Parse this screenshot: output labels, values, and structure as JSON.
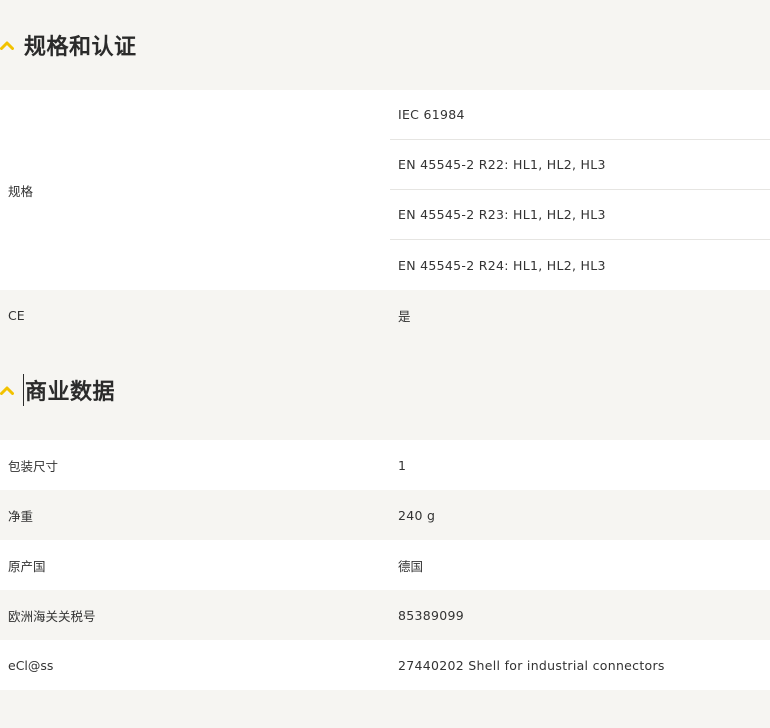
{
  "spec_section": {
    "title": "规格和认证",
    "rows": [
      {
        "label": "规格",
        "values": [
          "IEC 61984",
          "EN 45545-2 R22: HL1, HL2, HL3",
          "EN 45545-2 R23: HL1, HL2, HL3",
          "EN 45545-2 R24: HL1, HL2, HL3"
        ]
      },
      {
        "label": "CE",
        "value": "是"
      }
    ]
  },
  "commercial_section": {
    "title": "商业数据",
    "rows": [
      {
        "label": "包装尺寸",
        "value": "1"
      },
      {
        "label": "净重",
        "value": "240 g"
      },
      {
        "label": "原产国",
        "value": "德国"
      },
      {
        "label": "欧洲海关关税号",
        "value": "85389099"
      },
      {
        "label": "eCl@ss",
        "value": "27440202 Shell for industrial connectors"
      }
    ]
  },
  "colors": {
    "accent": "#f2c200",
    "background": "#f6f5f2",
    "row_white": "#ffffff"
  }
}
